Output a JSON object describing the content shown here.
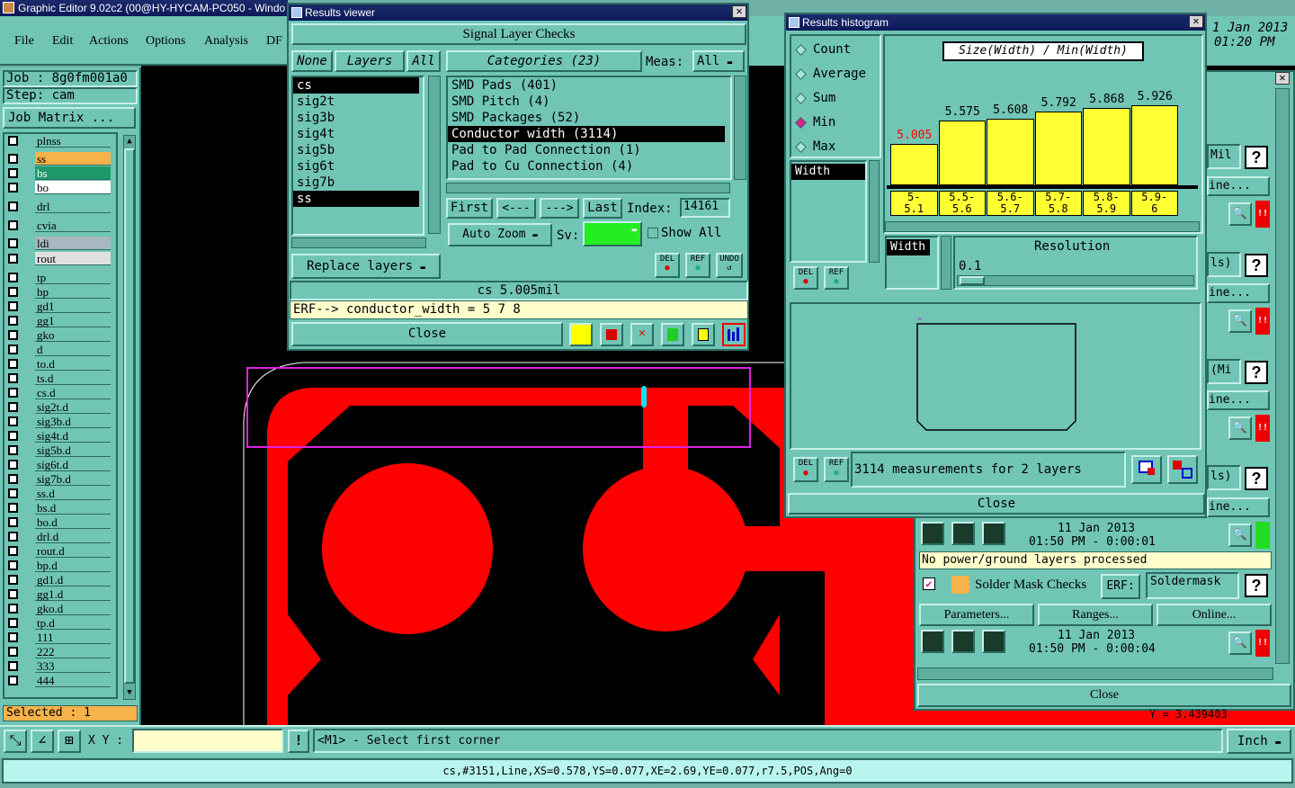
{
  "main_window": {
    "title": "Graphic Editor 9.02c2 (00@HY-HYCAM-PC050 - Windo",
    "menu": [
      "File",
      "Edit",
      "Actions",
      "Options",
      "Analysis",
      "DF"
    ],
    "job_label": "Job : 8g0fm001a0",
    "step_label": "Step: cam",
    "job_matrix_button": "Job Matrix ...",
    "selected_label": "Selected : 1",
    "xy_label": "X Y :",
    "prompt_text": "<M1> - Select first corner",
    "units_button": "Inch",
    "status_bar": "cs,#3151,Line,XS=0.578,YS=0.077,XE=2.69,YE=0.077,r7.5,POS,Ang=0",
    "clock_date": "1 Jan 2013",
    "clock_time": "01:20 PM",
    "coord_readout": "Y = 3.439403"
  },
  "layers": [
    {
      "name": "plnss",
      "color": "#71c5b5"
    },
    {
      "name": "ss",
      "color": "#f7b24a"
    },
    {
      "name": "bs",
      "color": "#1e9a6a"
    },
    {
      "name": "bo",
      "color": "#ffffff"
    },
    {
      "name": "drl",
      "color": "#71c5b5"
    },
    {
      "name": "cvia",
      "color": "#71c5b5"
    },
    {
      "name": "ldi",
      "color": "#a8b8c0"
    },
    {
      "name": "rout",
      "color": "#e0e0e0"
    },
    {
      "name": "tp",
      "color": "#71c5b5"
    },
    {
      "name": "bp",
      "color": "#71c5b5"
    },
    {
      "name": "gd1",
      "color": "#71c5b5"
    },
    {
      "name": "gg1",
      "color": "#71c5b5"
    },
    {
      "name": "gko",
      "color": "#71c5b5"
    },
    {
      "name": "d",
      "color": "#71c5b5"
    },
    {
      "name": "to.d",
      "color": "#71c5b5"
    },
    {
      "name": "ts.d",
      "color": "#71c5b5"
    },
    {
      "name": "cs.d",
      "color": "#71c5b5"
    },
    {
      "name": "sig2t.d",
      "color": "#71c5b5"
    },
    {
      "name": "sig3b.d",
      "color": "#71c5b5"
    },
    {
      "name": "sig4t.d",
      "color": "#71c5b5"
    },
    {
      "name": "sig5b.d",
      "color": "#71c5b5"
    },
    {
      "name": "sig6t.d",
      "color": "#71c5b5"
    },
    {
      "name": "sig7b.d",
      "color": "#71c5b5"
    },
    {
      "name": "ss.d",
      "color": "#71c5b5"
    },
    {
      "name": "bs.d",
      "color": "#71c5b5"
    },
    {
      "name": "bo.d",
      "color": "#71c5b5"
    },
    {
      "name": "drl.d",
      "color": "#71c5b5"
    },
    {
      "name": "rout.d",
      "color": "#71c5b5"
    },
    {
      "name": "bp.d",
      "color": "#71c5b5"
    },
    {
      "name": "gd1.d",
      "color": "#71c5b5"
    },
    {
      "name": "gg1.d",
      "color": "#71c5b5"
    },
    {
      "name": "gko.d",
      "color": "#71c5b5"
    },
    {
      "name": "tp.d",
      "color": "#71c5b5"
    },
    {
      "name": "111",
      "color": "#71c5b5"
    },
    {
      "name": "222",
      "color": "#71c5b5"
    },
    {
      "name": "333",
      "color": "#71c5b5"
    },
    {
      "name": "444",
      "color": "#71c5b5"
    }
  ],
  "results_viewer": {
    "title": "Results viewer",
    "header": "Signal Layer Checks",
    "none_button": "None",
    "layers_button": "Layers",
    "all_button": "All",
    "categories_button": "Categories (23)",
    "meas_label": "Meas:",
    "meas_value": "All",
    "layers_list": [
      "cs",
      "sig2t",
      "sig3b",
      "sig4t",
      "sig5b",
      "sig6t",
      "sig7b",
      "ss"
    ],
    "categories_list": [
      "SMD Pads (401)",
      "SMD Pitch (4)",
      "SMD Packages (52)",
      "Conductor width (3114)",
      "Pad to Pad Connection (1)",
      "Pad to Cu Connection (4)"
    ],
    "first_button": "First",
    "prev_button": "<---",
    "next_button": "--->",
    "last_button": "Last",
    "index_label": "Index:",
    "index_value": "14161",
    "auto_zoom": "Auto Zoom",
    "sv_label": "Sv:",
    "show_all": "Show All",
    "replace_layers": "Replace layers",
    "del_label": "DEL",
    "ref_label": "REF",
    "undo_label": "UNDO",
    "measurement": "cs 5.005mil",
    "erf_line": "ERF--> conductor_width = 5 7 8",
    "close_button": "Close"
  },
  "histogram": {
    "title": "Results histogram",
    "options": [
      "Count",
      "Average",
      "Sum",
      "Min",
      "Max"
    ],
    "selected_option": "Min",
    "measure_list": [
      "Width"
    ],
    "chart_title": "Size(Width) / Min(Width)",
    "width_label": "Width",
    "resolution_label": "Resolution",
    "resolution_value": "0.1",
    "del_label": "DEL",
    "ref_label": "REF",
    "summary": "3114 measurements for 2 layers",
    "close_button": "Close",
    "chart_data": {
      "type": "bar",
      "title": "Size(Width) / Min(Width)",
      "categories": [
        "5-5.1",
        "5.5-5.6",
        "5.6-5.7",
        "5.7-5.8",
        "5.8-5.9",
        "5.9-6"
      ],
      "category_labels_top": [
        "5-",
        "5.5-",
        "5.6-",
        "5.7-",
        "5.8-",
        "5.9-"
      ],
      "category_labels_bottom": [
        "5.1",
        "5.6",
        "5.7",
        "5.8",
        "5.9",
        "6"
      ],
      "values": [
        5.005,
        5.575,
        5.608,
        5.792,
        5.868,
        5.926
      ],
      "value_labels": [
        "5.005",
        "5.575",
        "5.608",
        "5.792",
        "5.868",
        "5.926"
      ],
      "highlight_color": "#ff0000",
      "bar_color": "#ffff33"
    }
  },
  "checks_panel": {
    "rows": [
      {
        "frag": "Mil"
      },
      {
        "frag": "ine..."
      },
      {
        "frag": "ls)"
      },
      {
        "frag": "ine..."
      },
      {
        "frag": "(Mi"
      },
      {
        "frag": "ine..."
      },
      {
        "frag": "ls)"
      },
      {
        "frag": "ine..."
      }
    ],
    "power_date": "11 Jan 2013",
    "power_time": "01:50 PM - 0:00:01",
    "power_message": "No power/ground layers processed",
    "soldermask_title": "Solder Mask Checks",
    "erf_label": "ERF:",
    "erf_value": "Soldermask",
    "parameters_button": "Parameters...",
    "ranges_button": "Ranges...",
    "online_button": "Online...",
    "sm_date": "11 Jan 2013",
    "sm_time": "01:50 PM - 0:00:04",
    "close_button": "Close",
    "help_glyph": "?",
    "alert_glyph": "!!"
  }
}
